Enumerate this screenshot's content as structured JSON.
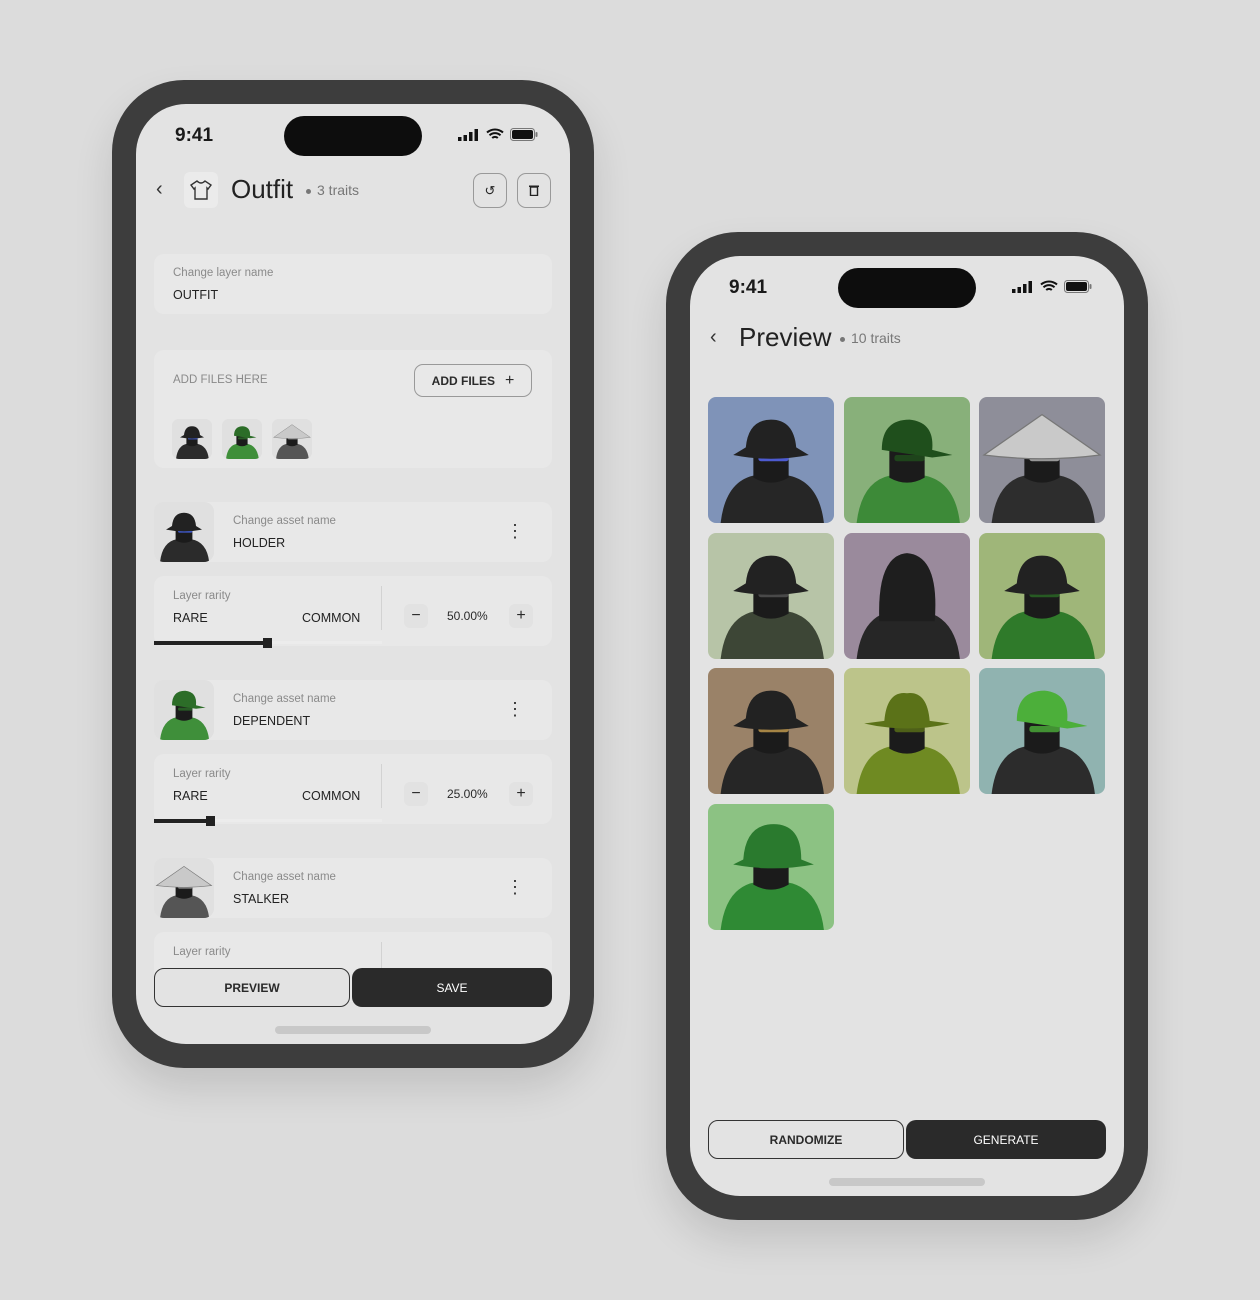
{
  "colors": {
    "frame": "#3d3d3d",
    "screen": "#e3e3e3",
    "dark_button": "#2a2a2a"
  },
  "editor": {
    "status_time": "9:41",
    "back_icon": "chevron-left-icon",
    "layer_icon": "tshirt-icon",
    "title": "Outfit",
    "trait_count": "3 traits",
    "actions": [
      {
        "icon": "undo-icon"
      },
      {
        "icon": "trash-icon"
      }
    ],
    "layer_name": {
      "label": "Change layer name",
      "value": "OUTFIT"
    },
    "add_files": {
      "label": "ADD FILES HERE",
      "button": "ADD FILES",
      "button_icon": "plus-icon",
      "thumbnails": [
        {
          "hat": "bucket",
          "body": "#2b2b2b",
          "accent": "#4a6cff",
          "bg": "#e0e0e0"
        },
        {
          "hat": "cap",
          "body": "#3f8f3a",
          "accent": "#2c6d28",
          "bg": "#e0e0e0"
        },
        {
          "hat": "conical",
          "body": "#555",
          "accent": "#aaa",
          "bg": "#e0e0e0"
        }
      ]
    },
    "assets": [
      {
        "label": "Change asset name",
        "name": "HOLDER",
        "rarity_label": "Layer rarity",
        "rare": "RARE",
        "common": "COMMON",
        "percent": "50.00%",
        "slider_value": 0.5,
        "avatar": {
          "hat": "bucket",
          "body": "#2b2b2b",
          "accent": "#4a6cff",
          "bg": "#e0e0e0"
        }
      },
      {
        "label": "Change asset name",
        "name": "DEPENDENT",
        "rarity_label": "Layer rarity",
        "rare": "RARE",
        "common": "COMMON",
        "percent": "25.00%",
        "slider_value": 0.25,
        "avatar": {
          "hat": "cap",
          "body": "#3f8f3a",
          "accent": "#2c6d28",
          "bg": "#e0e0e0"
        }
      },
      {
        "label": "Change asset name",
        "name": "STALKER",
        "rarity_label": "Layer rarity",
        "avatar": {
          "hat": "conical",
          "body": "#555",
          "accent": "#aaa",
          "bg": "#e0e0e0"
        }
      }
    ],
    "buttons": {
      "preview": "PREVIEW",
      "save": "SAVE"
    }
  },
  "preview": {
    "status_time": "9:41",
    "title": "Preview",
    "trait_count": "10 traits",
    "tiles": [
      {
        "bg": "#7f93b8",
        "hat": "bucket",
        "body": "#262626",
        "accent": "#5a6cff"
      },
      {
        "bg": "#88b07a",
        "hat": "cap",
        "body": "#3d8a38",
        "accent": "#1f4f1c"
      },
      {
        "bg": "#8e8e99",
        "hat": "conical",
        "body": "#2d2d2d",
        "accent": "#b8b8b8"
      },
      {
        "bg": "#b7c4a7",
        "hat": "bucket",
        "body": "#3d4636",
        "accent": "#555"
      },
      {
        "bg": "#9a8a9c",
        "hat": "hood",
        "body": "#262626",
        "accent": "#333"
      },
      {
        "bg": "#9fb679",
        "hat": "bucket",
        "body": "#2f7a2a",
        "accent": "#2b6a26"
      },
      {
        "bg": "#9a8268",
        "hat": "bucket",
        "body": "#262626",
        "accent": "#c9a050"
      },
      {
        "bg": "#bcc48a",
        "hat": "fedora",
        "body": "#6f8a22",
        "accent": "#5b7218"
      },
      {
        "bg": "#90b3b0",
        "hat": "cap",
        "body": "#2c2c2c",
        "accent": "#4caf3a"
      },
      {
        "bg": "#8cc283",
        "hat": "deerstalker",
        "body": "#2f8a34",
        "accent": "#2a7a2e"
      }
    ],
    "buttons": {
      "randomize": "RANDOMIZE",
      "generate": "GENERATE"
    }
  }
}
